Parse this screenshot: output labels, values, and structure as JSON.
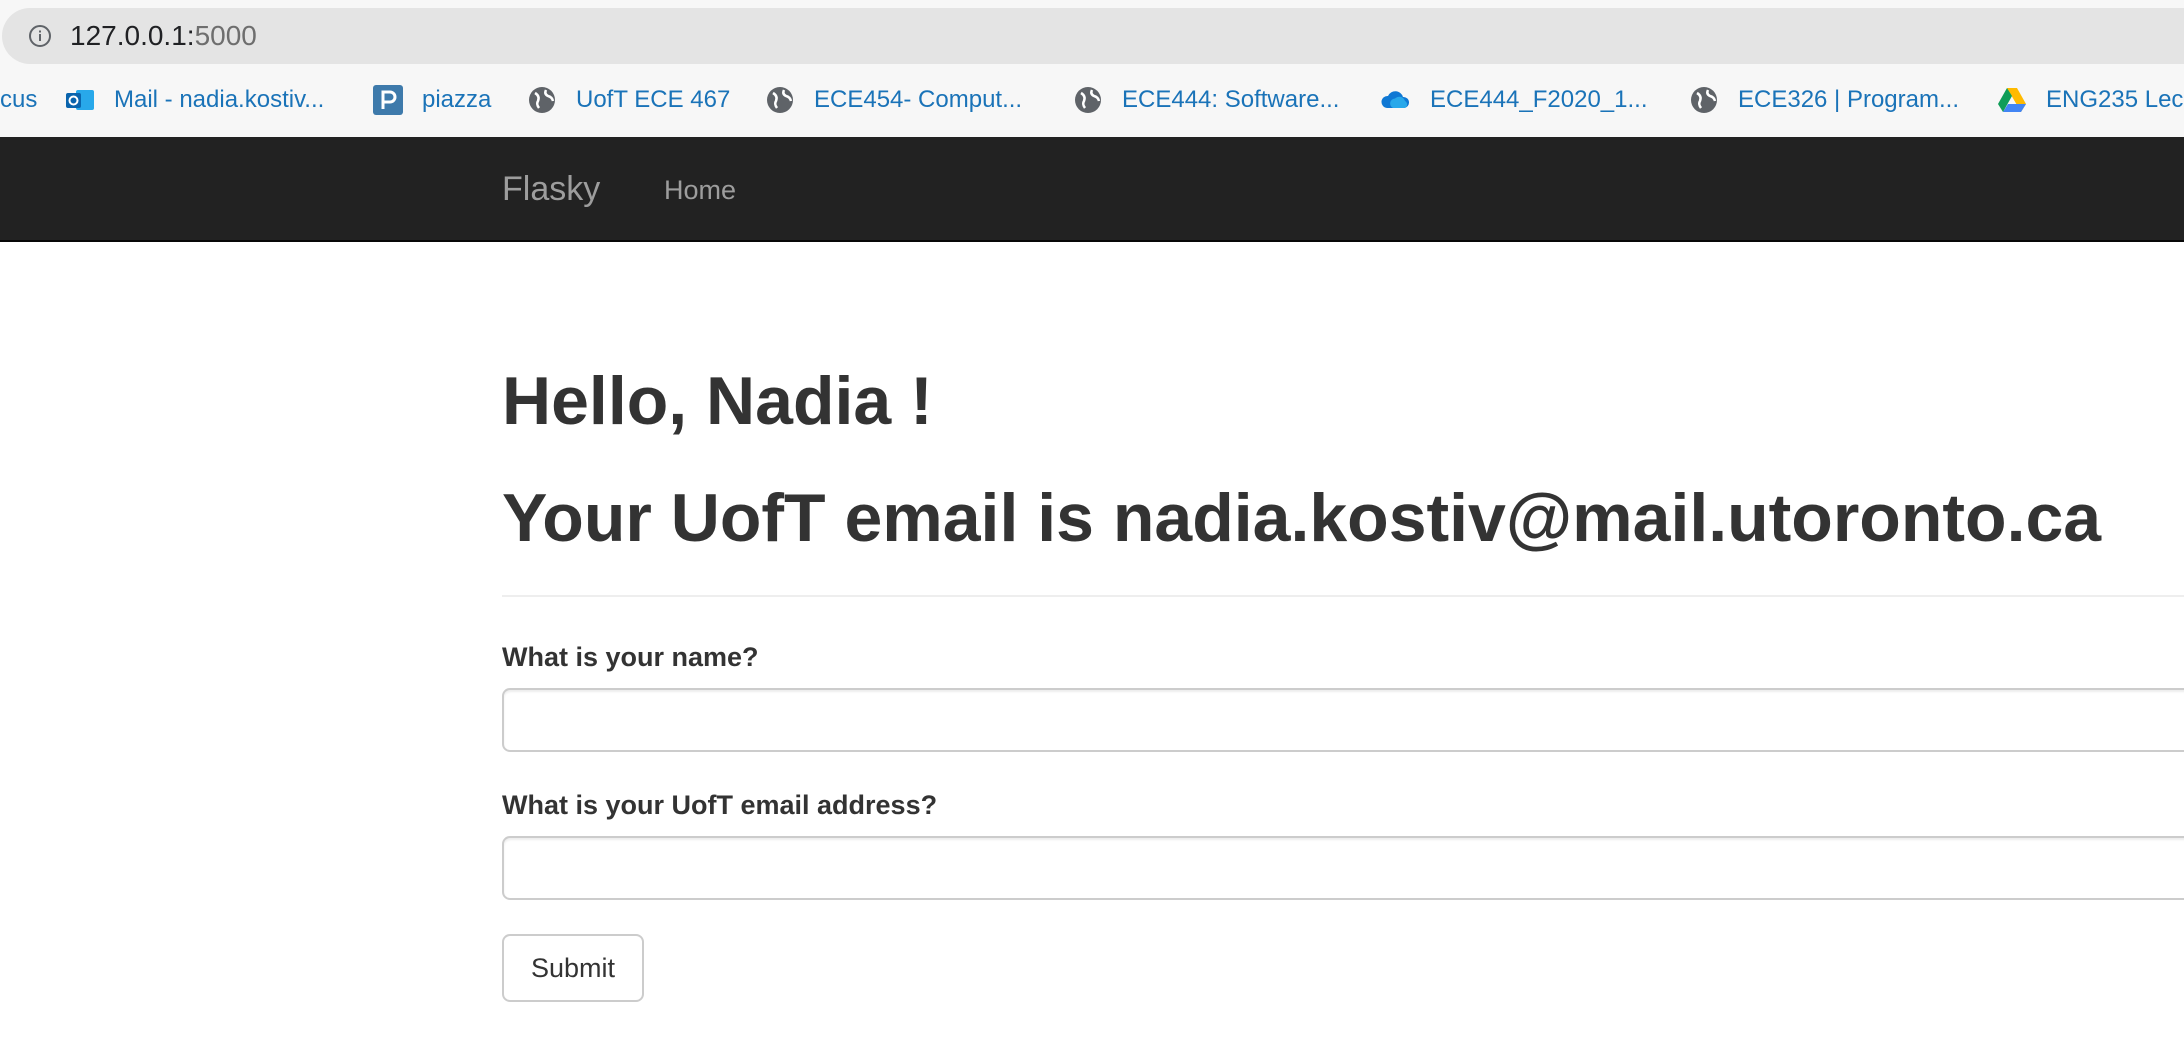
{
  "browser": {
    "url_host": "127.0.0.1:",
    "url_port": "5000",
    "bookmarks": [
      {
        "label": "cus",
        "icon": "none"
      },
      {
        "label": "Mail - nadia.kostiv...",
        "icon": "outlook-icon"
      },
      {
        "label": "piazza",
        "icon": "piazza-icon"
      },
      {
        "label": "UofT ECE 467",
        "icon": "globe-icon"
      },
      {
        "label": "ECE454- Comput...",
        "icon": "globe-icon"
      },
      {
        "label": "ECE444: Software...",
        "icon": "globe-icon"
      },
      {
        "label": "ECE444_F2020_1...",
        "icon": "onedrive-icon"
      },
      {
        "label": "ECE326 | Program...",
        "icon": "globe-icon"
      },
      {
        "label": "ENG235 Lec",
        "icon": "google-drive-icon"
      }
    ]
  },
  "navbar": {
    "brand": "Flasky",
    "home": "Home"
  },
  "main": {
    "greeting": "Hello, Nadia !",
    "email_line": "Your UofT email is nadia.kostiv@mail.utoronto.ca",
    "form": {
      "name_label": "What is your name?",
      "name_value": "",
      "email_label": "What is your UofT email address?",
      "email_value": "",
      "submit_label": "Submit"
    }
  },
  "colors": {
    "navbar_bg": "#222222",
    "navbar_text": "#9d9d9d",
    "heading_text": "#333333",
    "bookmark_text": "#1a73b8"
  }
}
